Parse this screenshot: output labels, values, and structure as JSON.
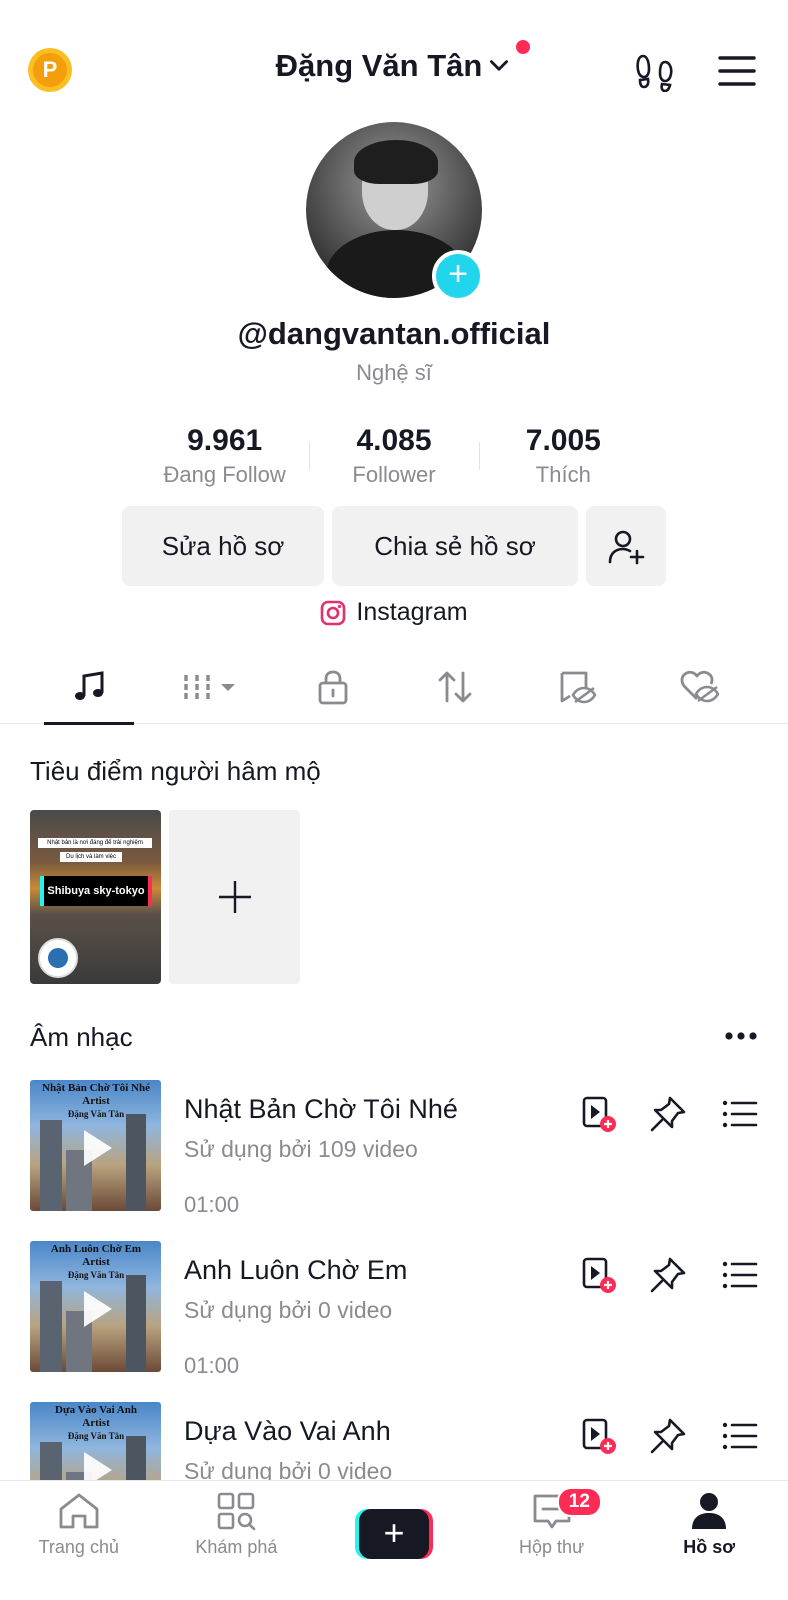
{
  "header": {
    "coin_letter": "P",
    "account_name": "Đặng Văn Tân"
  },
  "profile": {
    "username": "@dangvantan.official",
    "category": "Nghệ sĩ",
    "stats": [
      {
        "value": "9.961",
        "label": "Đang Follow"
      },
      {
        "value": "4.085",
        "label": "Follower"
      },
      {
        "value": "7.005",
        "label": "Thích"
      }
    ],
    "edit_label": "Sửa hồ sơ",
    "share_label": "Chia sẻ hồ sơ",
    "instagram_label": "Instagram"
  },
  "tabs": [
    "music",
    "videos",
    "private",
    "reposts",
    "favorites-hidden",
    "liked-hidden"
  ],
  "fan_spotlight": {
    "title": "Tiêu điểm người hâm mộ",
    "thumb_caption_1": "Nhật bản là nơi đáng để trải nghiệm",
    "thumb_caption_2": "Du lịch và làm việc",
    "thumb_tag": "Shibuya sky-tokyo"
  },
  "music": {
    "title": "Âm nhạc",
    "tracks": [
      {
        "name": "Nhật Bản Chờ Tôi Nhé",
        "uses": "Sử dụng bởi 109 video",
        "duration": "01:00",
        "cover_title": "Nhật Bản Chờ Tôi Nhé",
        "cover_artist_label": "Artist",
        "cover_artist": "Đặng Văn Tân"
      },
      {
        "name": "Anh Luôn Chờ Em",
        "uses": "Sử dụng bởi 0 video",
        "duration": "01:00",
        "cover_title": "Anh Luôn Chờ Em",
        "cover_artist_label": "Artist",
        "cover_artist": "Đặng Văn Tân"
      },
      {
        "name": "Dựa Vào Vai Anh",
        "uses": "Sử dụng bởi 0 video",
        "duration": "",
        "cover_title": "Dựa Vào Vai Anh",
        "cover_artist_label": "Artist",
        "cover_artist": "Đặng Văn Tân"
      }
    ]
  },
  "bottom_nav": {
    "home": "Trang chủ",
    "explore": "Khám phá",
    "inbox": "Hộp thư",
    "inbox_badge": "12",
    "profile": "Hồ sơ"
  },
  "colors": {
    "accent_cyan": "#20d5ec",
    "accent_red": "#fe2c55",
    "text_primary": "#161823",
    "text_secondary": "#8a8b91"
  }
}
